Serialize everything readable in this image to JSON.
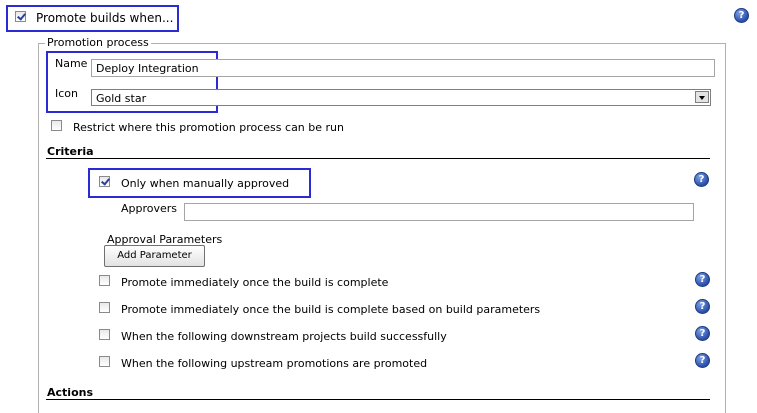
{
  "header": {
    "promote_label": "Promote builds when..."
  },
  "process": {
    "legend": "Promotion process",
    "name_label": "Name",
    "name_value": "Deploy Integration",
    "icon_label": "Icon",
    "icon_value": "Gold star",
    "restrict_label": "Restrict where this promotion process can be run"
  },
  "criteria": {
    "title": "Criteria",
    "manual_label": "Only when manually approved",
    "approvers_label": "Approvers",
    "approvers_value": "",
    "approval_params_label": "Approval Parameters",
    "add_parameter_label": "Add Parameter",
    "options": [
      {
        "label": "Promote immediately once the build is complete"
      },
      {
        "label": "Promote immediately once the build is complete based on build parameters"
      },
      {
        "label": "When the following downstream projects build successfully"
      },
      {
        "label": "When the following upstream promotions are promoted"
      }
    ]
  },
  "actions": {
    "title": "Actions"
  },
  "icons": {
    "help": "?"
  }
}
